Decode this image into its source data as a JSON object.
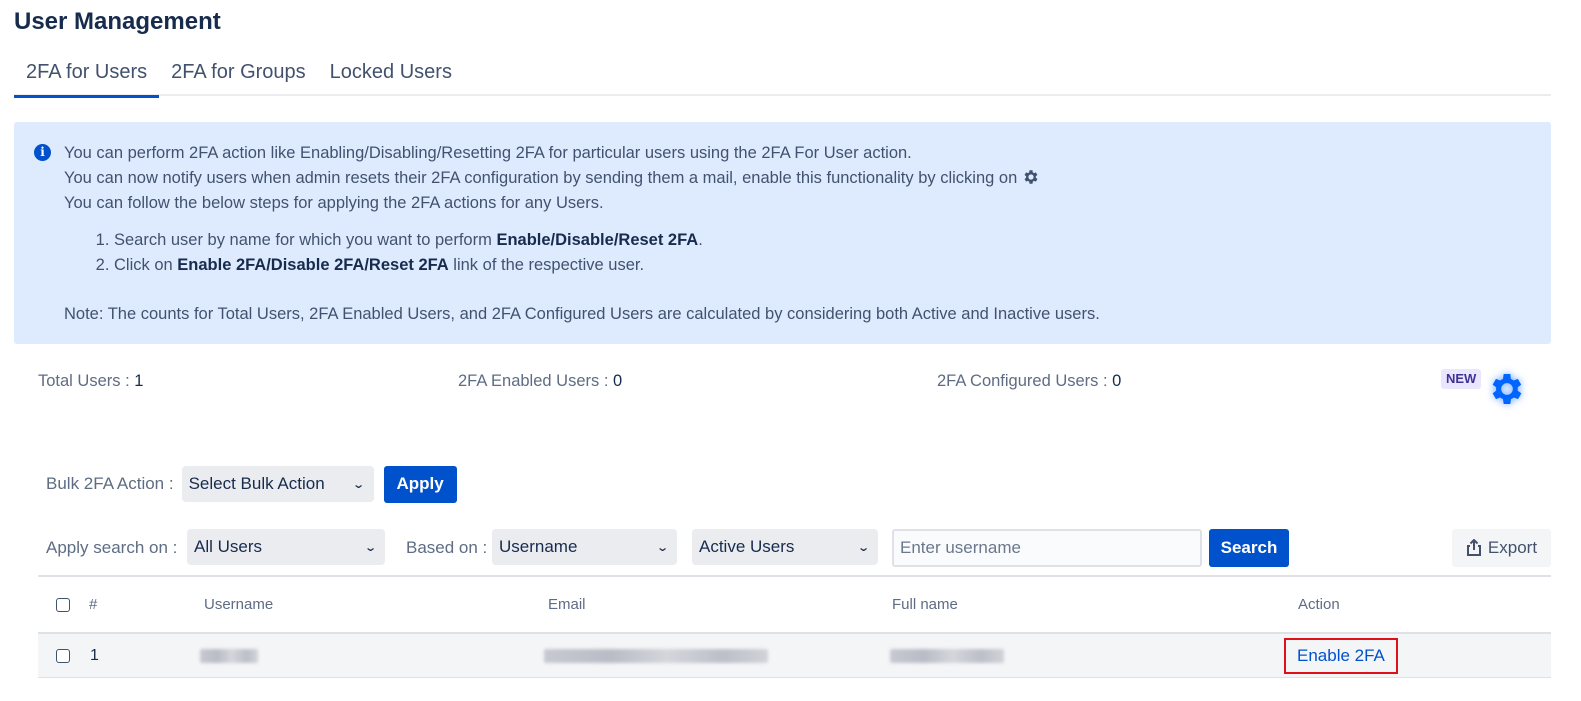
{
  "page": {
    "title": "User Management"
  },
  "tabs": [
    {
      "label": "2FA for Users",
      "active": true
    },
    {
      "label": "2FA for Groups",
      "active": false
    },
    {
      "label": "Locked Users",
      "active": false
    }
  ],
  "info": {
    "icon": "info-icon",
    "line1": "You can perform 2FA action like Enabling/Disabling/Resetting 2FA for particular users using the 2FA For User action.",
    "line2": "You can now notify users when admin resets their 2FA configuration by sending them a mail, enable this functionality by clicking on",
    "line2_icon": "gear-icon",
    "line3": "You can follow the below steps for applying the 2FA actions for any Users.",
    "steps": [
      {
        "prefix": "Search user by name for which you want to perform ",
        "bold": "Enable/Disable/Reset 2FA",
        "suffix": "."
      },
      {
        "prefix": "Click on ",
        "bold": "Enable 2FA/Disable 2FA/Reset 2FA",
        "suffix": " link of the respective user."
      }
    ],
    "note": "Note: The counts for Total Users, 2FA Enabled Users, and 2FA Configured Users are calculated by considering both Active and Inactive users."
  },
  "stats": {
    "total_label": "Total Users : ",
    "total_value": "1",
    "enabled_label": "2FA Enabled Users : ",
    "enabled_value": "0",
    "configured_label": "2FA Configured Users : ",
    "configured_value": "0",
    "new_badge": "NEW",
    "settings_icon": "gear-icon"
  },
  "bulk": {
    "label": "Bulk 2FA Action :",
    "select_value": "Select Bulk Action",
    "apply_label": "Apply"
  },
  "search": {
    "apply_on_label": "Apply search on :",
    "apply_on_value": "All Users",
    "based_on_label": "Based on :",
    "based_on_value": "Username",
    "status_value": "Active Users",
    "input_placeholder": "Enter username",
    "input_value": "",
    "search_label": "Search",
    "export_label": "Export",
    "export_icon": "upload-icon"
  },
  "table": {
    "columns": [
      "#",
      "Username",
      "Email",
      "Full name",
      "Action"
    ],
    "rows": [
      {
        "index": "1",
        "username": "[redacted]",
        "email": "[redacted]",
        "full_name": "[redacted]",
        "action": "Enable 2FA"
      }
    ]
  },
  "colors": {
    "primary": "#0052cc",
    "info_bg": "#deebff",
    "highlight_border": "#e0101a",
    "badge_bg": "#eae6ff",
    "badge_text": "#403294"
  }
}
